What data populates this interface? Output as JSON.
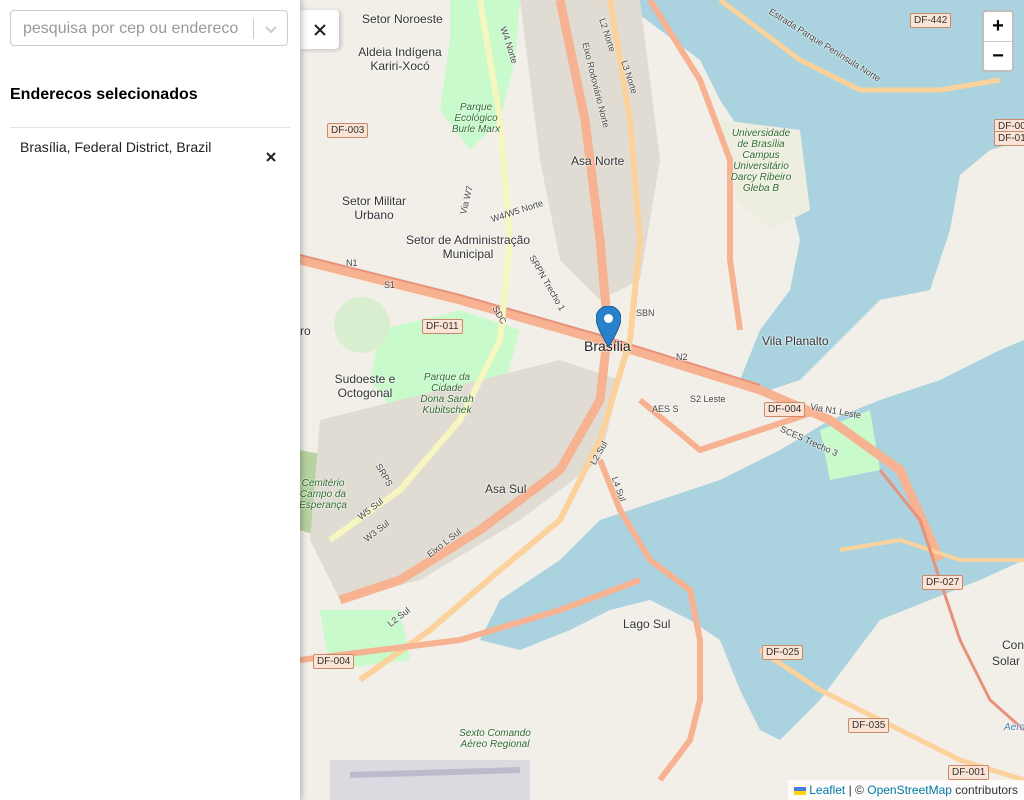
{
  "search": {
    "placeholder": "pesquisa por cep ou endereco",
    "value": ""
  },
  "sidebar": {
    "title": "Enderecos selecionados",
    "addresses": [
      {
        "label": "Brasília, Federal District, Brazil"
      }
    ]
  },
  "controls": {
    "close_symbol": "×",
    "zoom_in": "+",
    "zoom_out": "−"
  },
  "attribution": {
    "leaflet": "Leaflet",
    "separator": "| ©",
    "osm": "OpenStreetMap",
    "suffix": "contributors"
  },
  "map": {
    "marker_label": "Brasília",
    "places": {
      "setor_noroeste": "Setor Noroeste",
      "aldeia": "Aldeia Indígena Kariri-Xocó",
      "setor_militar": "Setor Militar Urbano",
      "setor_admin": "Setor de Administração Municipal",
      "asa_norte": "Asa Norte",
      "sudoeste": "Sudoeste e Octogonal",
      "asa_sul": "Asa Sul",
      "vila_planalto": "Vila Planalto",
      "lago_sul": "Lago Sul",
      "cemiterio": "Cemitério Campo da Esperança",
      "parque_burle": "Parque Ecológico Burle Marx",
      "parque_cidade": "Parque da Cidade Dona Sarah Kubitschek",
      "unb": "Universidade de Brasília Campus Universitário Darcy Ribeiro Gleba B",
      "sexto_comando": "Sexto Comando Aéreo Regional",
      "estrada_parque": "Estrada Parque Península Norte",
      "edge_ro": "ro",
      "edge_solar_1": "Cond",
      "edge_solar_2": "Solar",
      "edge_aero": "Aero"
    },
    "shields": [
      "DF-003",
      "DF-011",
      "DF-004",
      "DF-004",
      "DF-442",
      "DF-027",
      "DF-025",
      "DF-035",
      "DF-001",
      "DF-00",
      "DF-01"
    ],
    "roads": [
      "L2 Norte",
      "L3 Norte",
      "W4 Norte",
      "W4/W5 Norte",
      "Eixo Rodoviário Norte",
      "Via W7",
      "SRPN Trecho 1",
      "N1",
      "S1",
      "SDC",
      "SBN",
      "N2",
      "S2 Leste",
      "AES S",
      "Via N1 Leste",
      "SCES Trecho 3",
      "L2 Sul",
      "L4 Sul",
      "W3 Sul",
      "W5 Sul",
      "Eixo L Sul",
      "L2 Sul",
      "SRPS"
    ]
  }
}
